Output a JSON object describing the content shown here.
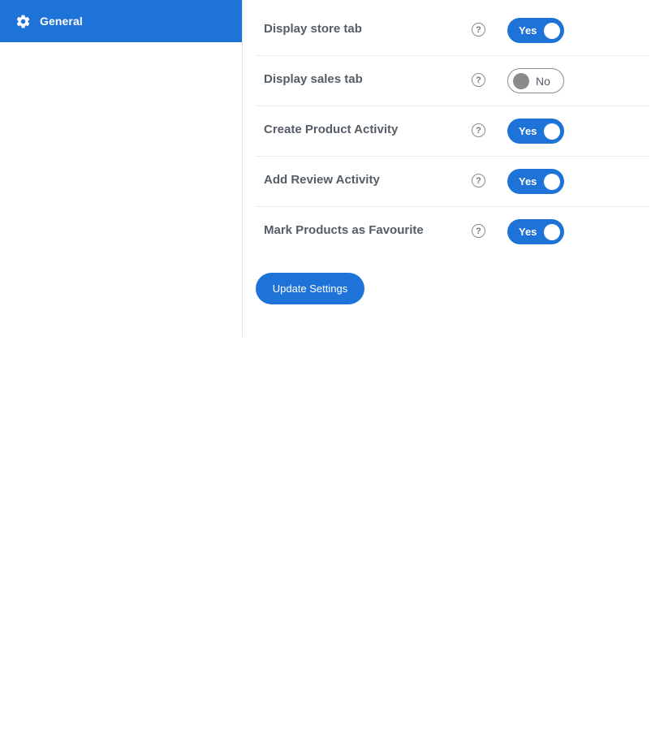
{
  "sidebar": {
    "items": [
      {
        "label": "General",
        "icon": "gear-icon",
        "active": true
      }
    ]
  },
  "settings": {
    "rows": [
      {
        "label": "Display store tab",
        "help": "?",
        "state": "Yes"
      },
      {
        "label": "Display sales tab",
        "help": "?",
        "state": "No"
      },
      {
        "label": "Create Product Activity",
        "help": "?",
        "state": "Yes"
      },
      {
        "label": "Add Review Activity",
        "help": "?",
        "state": "Yes"
      },
      {
        "label": "Mark Products as Favourite",
        "help": "?",
        "state": "Yes"
      }
    ]
  },
  "actions": {
    "update_label": "Update Settings"
  },
  "colors": {
    "accent": "#1e73d9",
    "label_text": "#555d66",
    "toggle_off_knob": "#8a8a8a"
  }
}
